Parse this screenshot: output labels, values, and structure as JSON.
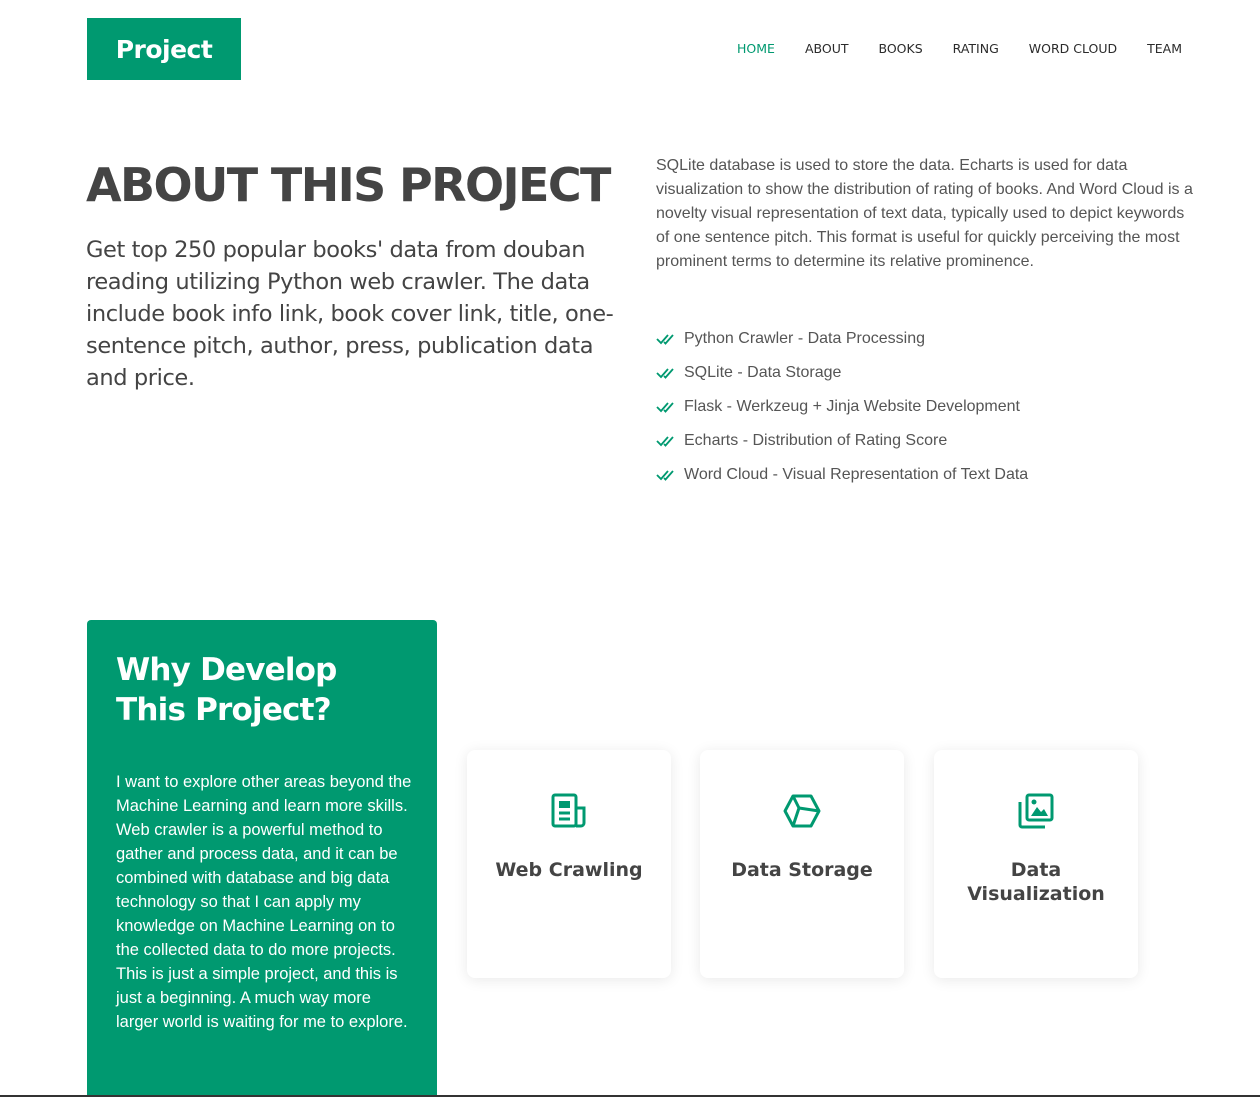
{
  "header": {
    "logo": "Project",
    "nav": [
      {
        "label": "HOME",
        "active": true
      },
      {
        "label": "ABOUT",
        "active": false
      },
      {
        "label": "BOOKS",
        "active": false
      },
      {
        "label": "RATING",
        "active": false
      },
      {
        "label": "WORD CLOUD",
        "active": false
      },
      {
        "label": "TEAM",
        "active": false
      }
    ]
  },
  "about": {
    "title": "ABOUT THIS PROJECT",
    "lead": "Get top 250 popular books' data from douban reading utilizing Python web crawler. The data include book info link, book cover link, title, one-sentence pitch, author, press, publication data and price.",
    "description": "SQLite database is used to store the data. Echarts is used for data visualization to show the distribution of rating of books. And Word Cloud is a novelty visual representation of text data, typically used to depict keywords of one sentence pitch. This format is useful for quickly perceiving the most prominent terms to determine its relative prominence.",
    "features": [
      "Python Crawler - Data Processing",
      "SQLite - Data Storage",
      "Flask - Werkzeug + Jinja Website Development",
      "Echarts - Distribution of Rating Score",
      "Word Cloud - Visual Representation of Text Data"
    ]
  },
  "why": {
    "title": "Why Develop This Project?",
    "text": "I want to explore other areas beyond the Machine Learning and learn more skills. Web crawler is a powerful method to gather and process data, and it can be combined with database and big data technology so that I can apply my knowledge on Machine Learning on to the collected data to do more projects. This is just a simple project, and this is just a beginning. A much way more larger world is waiting for me to explore."
  },
  "cards": [
    {
      "title": "Web Crawling",
      "icon": "newspaper-icon"
    },
    {
      "title": "Data Storage",
      "icon": "cube-icon"
    },
    {
      "title": "Data Visualization",
      "icon": "images-icon"
    }
  ],
  "colors": {
    "accent": "#009970",
    "text": "#444444"
  }
}
